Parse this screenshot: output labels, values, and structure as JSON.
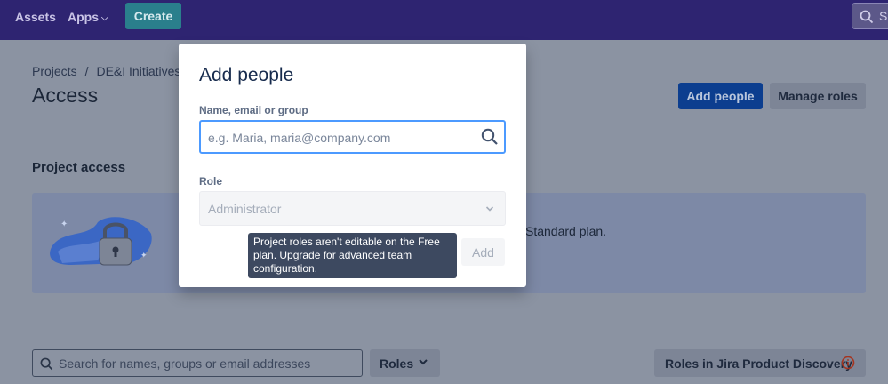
{
  "topnav": {
    "assets_label": "Assets",
    "apps_label": "Apps",
    "create_label": "Create",
    "search_text": "Se"
  },
  "page": {
    "breadcrumb": [
      "Projects",
      "DE&I Initiatives"
    ],
    "title": "Access",
    "add_people_label": "Add people",
    "manage_roles_label": "Manage roles",
    "section_heading": "Project access",
    "banner_text": "Standard plan."
  },
  "filters": {
    "search_placeholder": "Search for names, groups or email addresses",
    "roles_label": "Roles",
    "rjpd_label": "Roles in Jira Product Discovery"
  },
  "modal": {
    "title": "Add people",
    "name_label": "Name, email or group",
    "name_placeholder": "e.g. Maria, maria@company.com",
    "role_label": "Role",
    "role_value": "Administrator",
    "add_label": "Add",
    "tooltip": "Project roles aren't editable on the Free plan. Upgrade for advanced team configuration."
  },
  "colors": {
    "nav_bg": "#2e2471",
    "overlay_bg": "#8b93a2",
    "primary_button": "#0c3e8f",
    "input_focus": "#4c9aff",
    "tooltip_bg": "#3d4960"
  },
  "icons": [
    "search-icon",
    "chevron-down-icon",
    "info-icon",
    "lock-illustration"
  ]
}
